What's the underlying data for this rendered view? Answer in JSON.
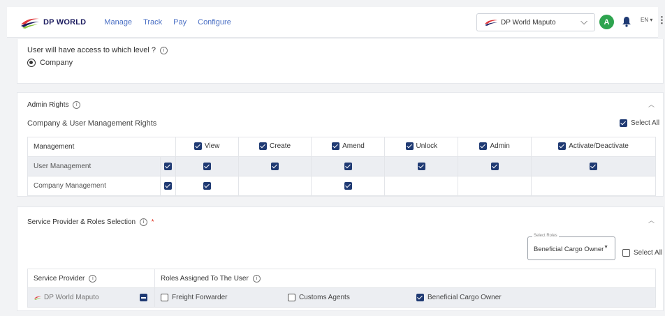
{
  "brand": {
    "name": "DP WORLD"
  },
  "nav": {
    "items": [
      "Manage",
      "Track",
      "Pay",
      "Configure"
    ]
  },
  "header": {
    "company": "DP World Maputo",
    "avatar_initial": "A",
    "language": "EN ▾"
  },
  "access": {
    "question": "User will have access to which level ?",
    "option": "Company"
  },
  "admin": {
    "title": "Admin Rights",
    "subtitle": "Company & User Management Rights",
    "select_all": "Select All",
    "columns": [
      "Management",
      "View",
      "Create",
      "Amend",
      "Unlock",
      "Admin",
      "Activate/Deactivate"
    ],
    "rows": [
      {
        "label": "User Management",
        "row_check": true,
        "checks": [
          true,
          true,
          true,
          true,
          true,
          true
        ]
      },
      {
        "label": "Company Management",
        "row_check": true,
        "checks": [
          true,
          false,
          true,
          false,
          false,
          false
        ]
      }
    ]
  },
  "service": {
    "title": "Service Provider & Roles Selection",
    "required_mark": "*",
    "roles_select_label": "Select Roles",
    "roles_select_value": "Beneficial Cargo Owner",
    "select_all": "Select All",
    "col_provider": "Service Provider",
    "col_roles": "Roles Assigned To The User",
    "provider": "DP World Maputo",
    "roles": [
      {
        "label": "Freight Forwarder",
        "checked": false
      },
      {
        "label": "Customs Agents",
        "checked": false
      },
      {
        "label": "Beneficial Cargo Owner",
        "checked": true
      }
    ]
  },
  "colors": {
    "accent": "#1f3a73",
    "nav_link": "#4a6fc4",
    "avatar": "#2ea44f"
  }
}
